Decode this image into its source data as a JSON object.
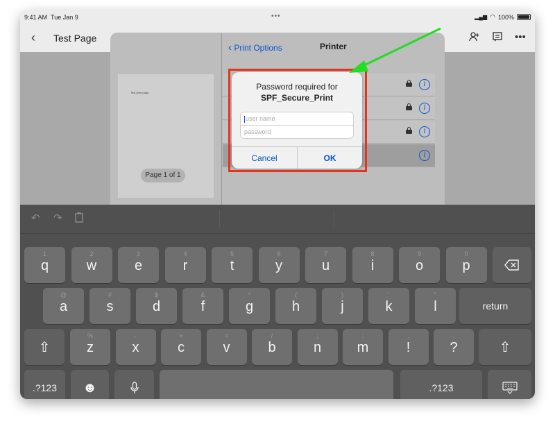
{
  "status_bar": {
    "time": "9:41 AM",
    "date": "Tue Jan 9",
    "battery": "100%"
  },
  "nav": {
    "title": "Test Page",
    "back_icon": "chevron-left",
    "icons": [
      "add-person-icon",
      "comment-icon",
      "more-icon"
    ]
  },
  "print_sheet": {
    "back_label": "Print Options",
    "title": "Printer",
    "preview_text": "Test print page",
    "page_indicator": "Page 1 of 1",
    "printer_rows": [
      {
        "locked": true
      },
      {
        "locked": true
      },
      {
        "locked": true
      },
      {
        "locked": false,
        "selected": true
      }
    ]
  },
  "alert": {
    "line1": "Password required for",
    "line2": "SPF_Secure_Print",
    "username_placeholder": "user name",
    "password_placeholder": "password",
    "cancel": "Cancel",
    "ok": "OK"
  },
  "annotation": {
    "highlight_color": "#e8331c",
    "arrow_color": "#22dd22"
  },
  "keyboard": {
    "row1": [
      {
        "main": "q",
        "sub": "1"
      },
      {
        "main": "w",
        "sub": "2"
      },
      {
        "main": "e",
        "sub": "3"
      },
      {
        "main": "r",
        "sub": "4"
      },
      {
        "main": "t",
        "sub": "5"
      },
      {
        "main": "y",
        "sub": "6"
      },
      {
        "main": "u",
        "sub": "7"
      },
      {
        "main": "i",
        "sub": "8"
      },
      {
        "main": "o",
        "sub": "9"
      },
      {
        "main": "p",
        "sub": "0"
      }
    ],
    "row2": [
      {
        "main": "a",
        "sub": "@"
      },
      {
        "main": "s",
        "sub": "#"
      },
      {
        "main": "d",
        "sub": "$"
      },
      {
        "main": "f",
        "sub": "&"
      },
      {
        "main": "g",
        "sub": "*"
      },
      {
        "main": "h",
        "sub": "("
      },
      {
        "main": "j",
        "sub": ")"
      },
      {
        "main": "k",
        "sub": "'"
      },
      {
        "main": "l",
        "sub": "\""
      }
    ],
    "row3": [
      {
        "main": "z",
        "sub": "%"
      },
      {
        "main": "x",
        "sub": "-"
      },
      {
        "main": "c",
        "sub": "+"
      },
      {
        "main": "v",
        "sub": "="
      },
      {
        "main": "b",
        "sub": "/"
      },
      {
        "main": "n",
        "sub": ";"
      },
      {
        "main": "m",
        "sub": ":"
      },
      {
        "main": "!",
        "sub": ","
      },
      {
        "main": "?",
        "sub": "."
      }
    ],
    "return_label": "return",
    "numbers_label": ".?123",
    "delete_icon": "backspace-icon",
    "shift_icon": "shift-icon",
    "emoji_icon": "emoji-icon",
    "mic_icon": "microphone-icon",
    "hide_icon": "keyboard-dismiss-icon"
  }
}
